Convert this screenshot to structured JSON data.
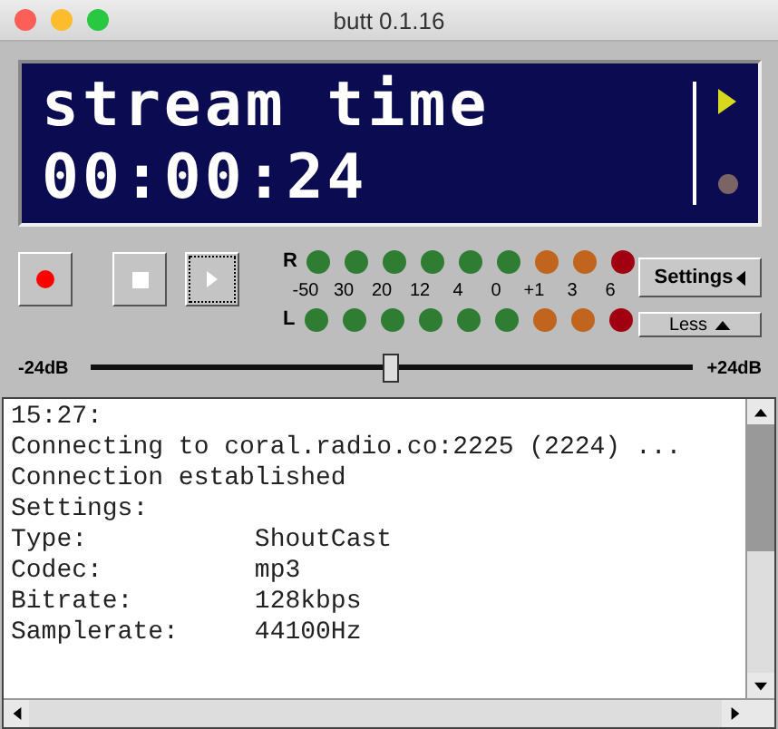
{
  "window": {
    "title": "butt 0.1.16"
  },
  "display": {
    "line_1": "stream time",
    "line_2": "00:00:24"
  },
  "transport": [
    {
      "kind": "record",
      "focused": false
    },
    {
      "kind": "stop",
      "focused": false
    },
    {
      "kind": "play",
      "focused": true
    }
  ],
  "meter": {
    "right_label": "R",
    "left_label": "L",
    "scale": [
      "-50",
      "30",
      "20",
      "12",
      "4",
      "0",
      "+1",
      "3",
      "6"
    ],
    "leds": [
      {
        "color": "#2e7d32"
      },
      {
        "color": "#2e7d32"
      },
      {
        "color": "#2e7d32"
      },
      {
        "color": "#2e7d32"
      },
      {
        "color": "#2e7d32"
      },
      {
        "color": "#2e7d32"
      },
      {
        "color": "#c0641e"
      },
      {
        "color": "#c0641e"
      },
      {
        "color": "#a00010"
      }
    ]
  },
  "settings_button": "Settings",
  "less_button": "Less",
  "gain": {
    "min_label": "-24dB",
    "max_label": "+24dB",
    "level": 0.5
  },
  "log": [
    {
      "label": "15:27:"
    },
    {
      "label": "Connecting to coral.radio.co:2225 (2224) ..."
    },
    {
      "label": "Connection established"
    },
    {
      "label": "Settings:"
    },
    {
      "label": "Type:",
      "value": "ShoutCast"
    },
    {
      "label": "Codec:",
      "value": "mp3"
    },
    {
      "label": "Bitrate:",
      "value": "128kbps"
    },
    {
      "label": "Samplerate:",
      "value": "44100Hz"
    }
  ]
}
